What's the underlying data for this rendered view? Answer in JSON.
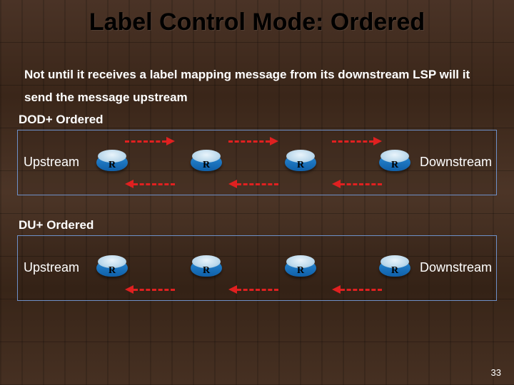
{
  "title": "Label Control Mode: Ordered",
  "description": "Not until it receives a label mapping message from its downstream LSP will it send the message upstream",
  "sections": {
    "dod": {
      "label": "DOD+ Ordered",
      "upstream": "Upstream",
      "downstream": "Downstream"
    },
    "du": {
      "label": "DU+ Ordered",
      "upstream": "Upstream",
      "downstream": "Downstream"
    }
  },
  "router_label": "R",
  "page_number": "33",
  "colors": {
    "arrow": "#e02020",
    "panel_border": "#6e90c8",
    "router_top": "#bcd9ec",
    "router_side": "#1a6fb8"
  }
}
